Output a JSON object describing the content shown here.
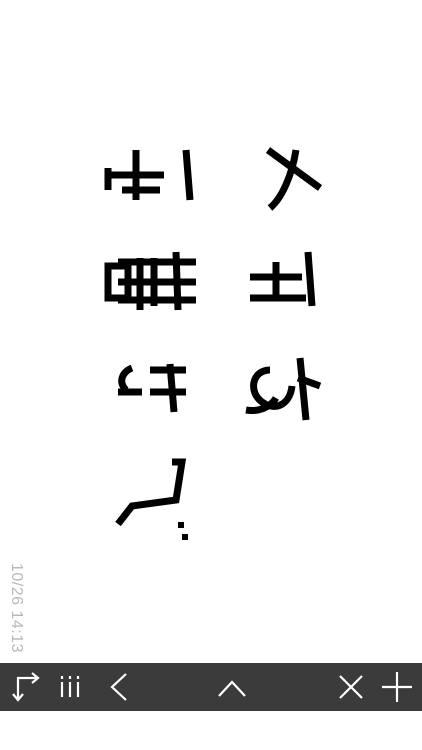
{
  "note": {
    "text_lines": [
      "メモを",
      "書き手"
    ],
    "timestamp": "10/26 14:13"
  },
  "toolbar": {
    "background": "#3b3b3b",
    "buttons": [
      {
        "icon": "rotate-icon",
        "label": "Rotate"
      },
      {
        "icon": "menu-icon",
        "label": "Menu"
      },
      {
        "icon": "chevron-left-icon",
        "label": "Back"
      },
      {
        "icon": "chevron-up-icon",
        "label": "Up"
      },
      {
        "icon": "close-icon",
        "label": "Close"
      },
      {
        "icon": "plus-icon",
        "label": "Add"
      }
    ]
  }
}
